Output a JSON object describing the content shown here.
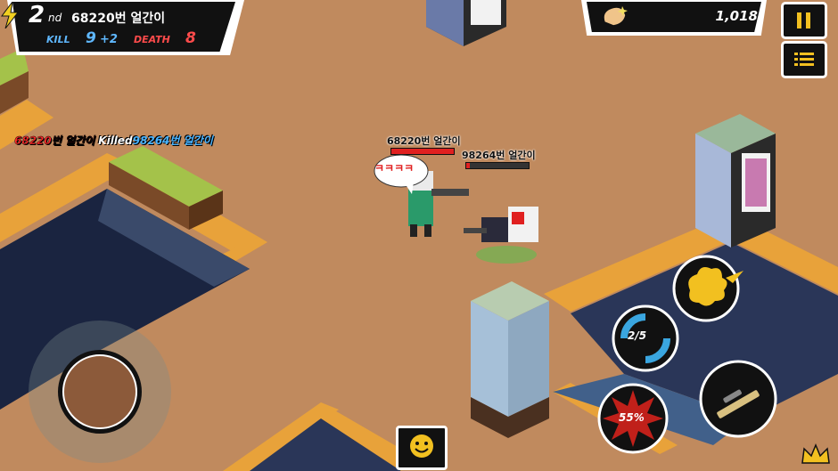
{
  "hud": {
    "rank_number": "2",
    "rank_suffix": "nd",
    "player_name": "68220번 얼간이",
    "kill_label": "KILL",
    "kill_count": "9",
    "kill_bonus": "+2",
    "death_label": "DEATH",
    "death_count": "8"
  },
  "currency": {
    "value": "1,018",
    "icon": "chip-coin-icon"
  },
  "controls": {
    "pause_icon": "pause-icon",
    "menu_icon": "menu-icon",
    "ammo": "2/5",
    "special_charge": "55%"
  },
  "killfeed": {
    "killer": "68220번 얼간이",
    "verb": "Killed",
    "victim": "98264번 얼간이"
  },
  "players": {
    "self_name": "68220번 얼간이",
    "self_speech": "ㅋㅋㅋㅋ",
    "enemy_name": "98264번 얼간이"
  },
  "colors": {
    "ground": "#c08a5e",
    "kill_blue": "#5fb8ff",
    "death_red": "#ff4b4b",
    "hp_red": "#e02020",
    "action_yellow": "#f2c020"
  },
  "chat_button_icon": "smiley-icon",
  "crown_icon": "crown-icon"
}
